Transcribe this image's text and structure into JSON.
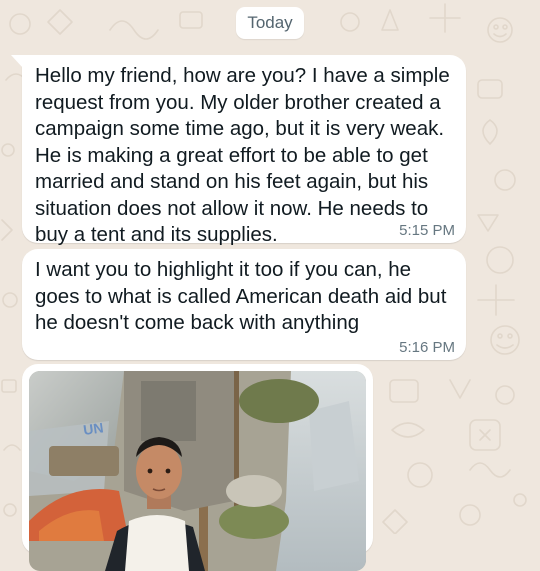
{
  "chat": {
    "date_label": "Today",
    "messages": [
      {
        "text": "Hello my friend, how are you? I have a simple request from you. My older brother created a campaign some time ago, but it is very weak. He is making a great effort to be able to get married and stand on his feet again, but his situation does not allow it now. He needs to buy a tent and its supplies.",
        "time": "5:15 PM"
      },
      {
        "text": "I want you to highlight it too if you can, he goes to what is called American death aid but he doesn't come back with anything",
        "time": "5:16 PM"
      }
    ],
    "photo": {
      "icon": "photo-attachment",
      "visible_label": "UN"
    }
  },
  "colors": {
    "wallpaper": "#efe7de",
    "bubble": "#ffffff",
    "text": "#111b21",
    "time": "#667781",
    "date_chip_text": "#54656f"
  }
}
